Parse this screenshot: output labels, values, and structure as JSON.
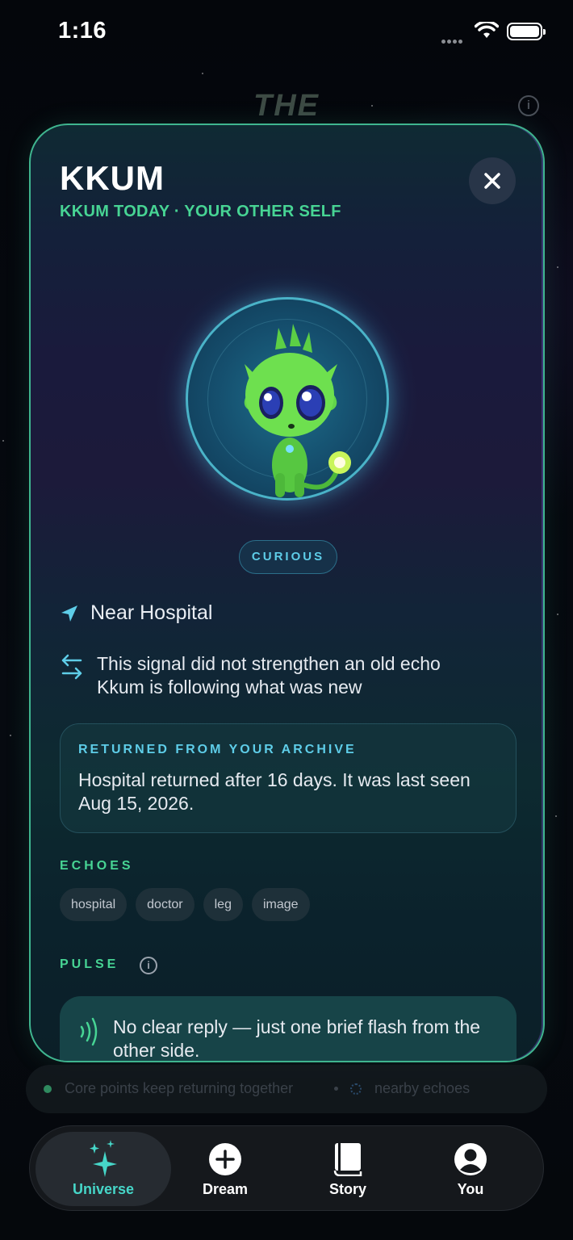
{
  "status_bar": {
    "time": "1:16"
  },
  "background": {
    "title": "THE"
  },
  "card": {
    "name": "KKUM",
    "subtitle": "KKUM TODAY · YOUR OTHER SELF",
    "mood": "CURIOUS",
    "location": "Near Hospital",
    "echo_line": "This signal did not strengthen an old echo Kkum is following what was new",
    "archive": {
      "heading": "RETURNED FROM YOUR ARCHIVE",
      "text": "Hospital returned after 16 days. It was last seen Aug 15, 2026."
    },
    "echoes": {
      "heading": "ECHOES",
      "chips": [
        "hospital",
        "doctor",
        "leg",
        "image"
      ]
    },
    "pulse": {
      "heading": "PULSE",
      "text": "No clear reply — just one brief flash from the other side."
    }
  },
  "banner": {
    "left_text": "Core points keep returning together",
    "right_text": "nearby echoes"
  },
  "tabbar": {
    "items": [
      {
        "label": "Universe",
        "icon": "sparkles-icon",
        "active": true
      },
      {
        "label": "Dream",
        "icon": "plus-circle-icon",
        "active": false
      },
      {
        "label": "Story",
        "icon": "book-icon",
        "active": false
      },
      {
        "label": "You",
        "icon": "person-circle-icon",
        "active": false
      }
    ]
  },
  "colors": {
    "accent_green": "#47d494",
    "accent_cyan": "#5ecde8",
    "active_tab": "#46d6c8",
    "card_border": "#3fb58f"
  }
}
